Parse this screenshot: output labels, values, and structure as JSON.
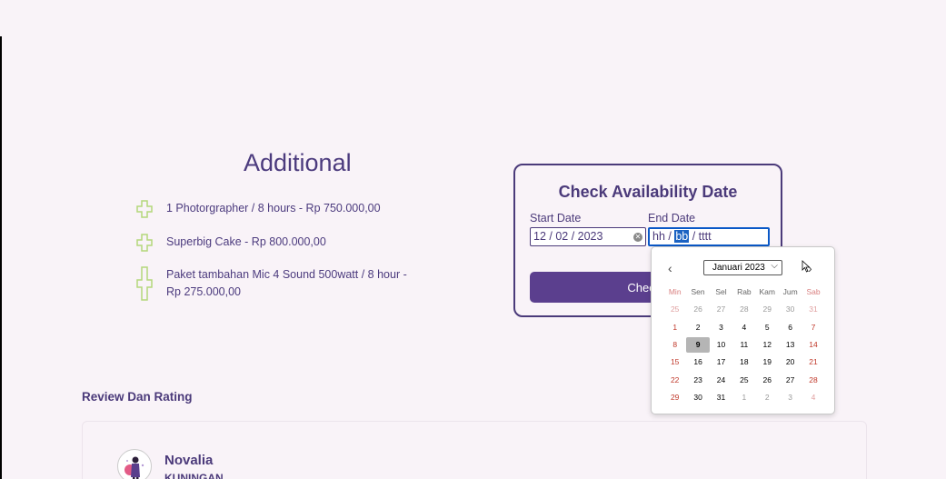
{
  "additional": {
    "title": "Additional",
    "items": [
      {
        "text": "1 Photorgrapher / 8 hours - Rp 750.000,00",
        "icon": "plus-outline-icon"
      },
      {
        "text": "Superbig Cake - Rp 800.000,00",
        "icon": "plus-outline-icon"
      },
      {
        "text": "Paket tambahan Mic 4 Sound 500watt / 8 hour - Rp 275.000,00",
        "icon": "plus-outline-icon"
      }
    ]
  },
  "availability": {
    "title": "Check Availability Date",
    "start_label": "Start Date",
    "end_label": "End Date",
    "start_day": "12",
    "start_month": "02",
    "start_year": "2023",
    "end_day": "hh",
    "end_month": "bb",
    "end_year": "tttt",
    "button_label": "Check V"
  },
  "calendar": {
    "month_label": "Januari 2023",
    "weekdays": [
      "Min",
      "Sen",
      "Sel",
      "Rab",
      "Kam",
      "Jum",
      "Sab"
    ],
    "weeks": [
      [
        "25",
        "26",
        "27",
        "28",
        "29",
        "30",
        "31"
      ],
      [
        "1",
        "2",
        "3",
        "4",
        "5",
        "6",
        "7"
      ],
      [
        "8",
        "9",
        "10",
        "11",
        "12",
        "13",
        "14"
      ],
      [
        "15",
        "16",
        "17",
        "18",
        "19",
        "20",
        "21"
      ],
      [
        "22",
        "23",
        "24",
        "25",
        "26",
        "27",
        "28"
      ],
      [
        "29",
        "30",
        "31",
        "1",
        "2",
        "3",
        "4"
      ]
    ],
    "selected_day": "9"
  },
  "review": {
    "title": "Review Dan Rating",
    "reviewer_name": "Novalia",
    "reviewer_city": "KUNINGAN"
  },
  "colors": {
    "primary": "#4b3a7a",
    "button": "#5b3f8e",
    "plus_icon": "#b4d87a",
    "background": "#f9f3f8"
  }
}
